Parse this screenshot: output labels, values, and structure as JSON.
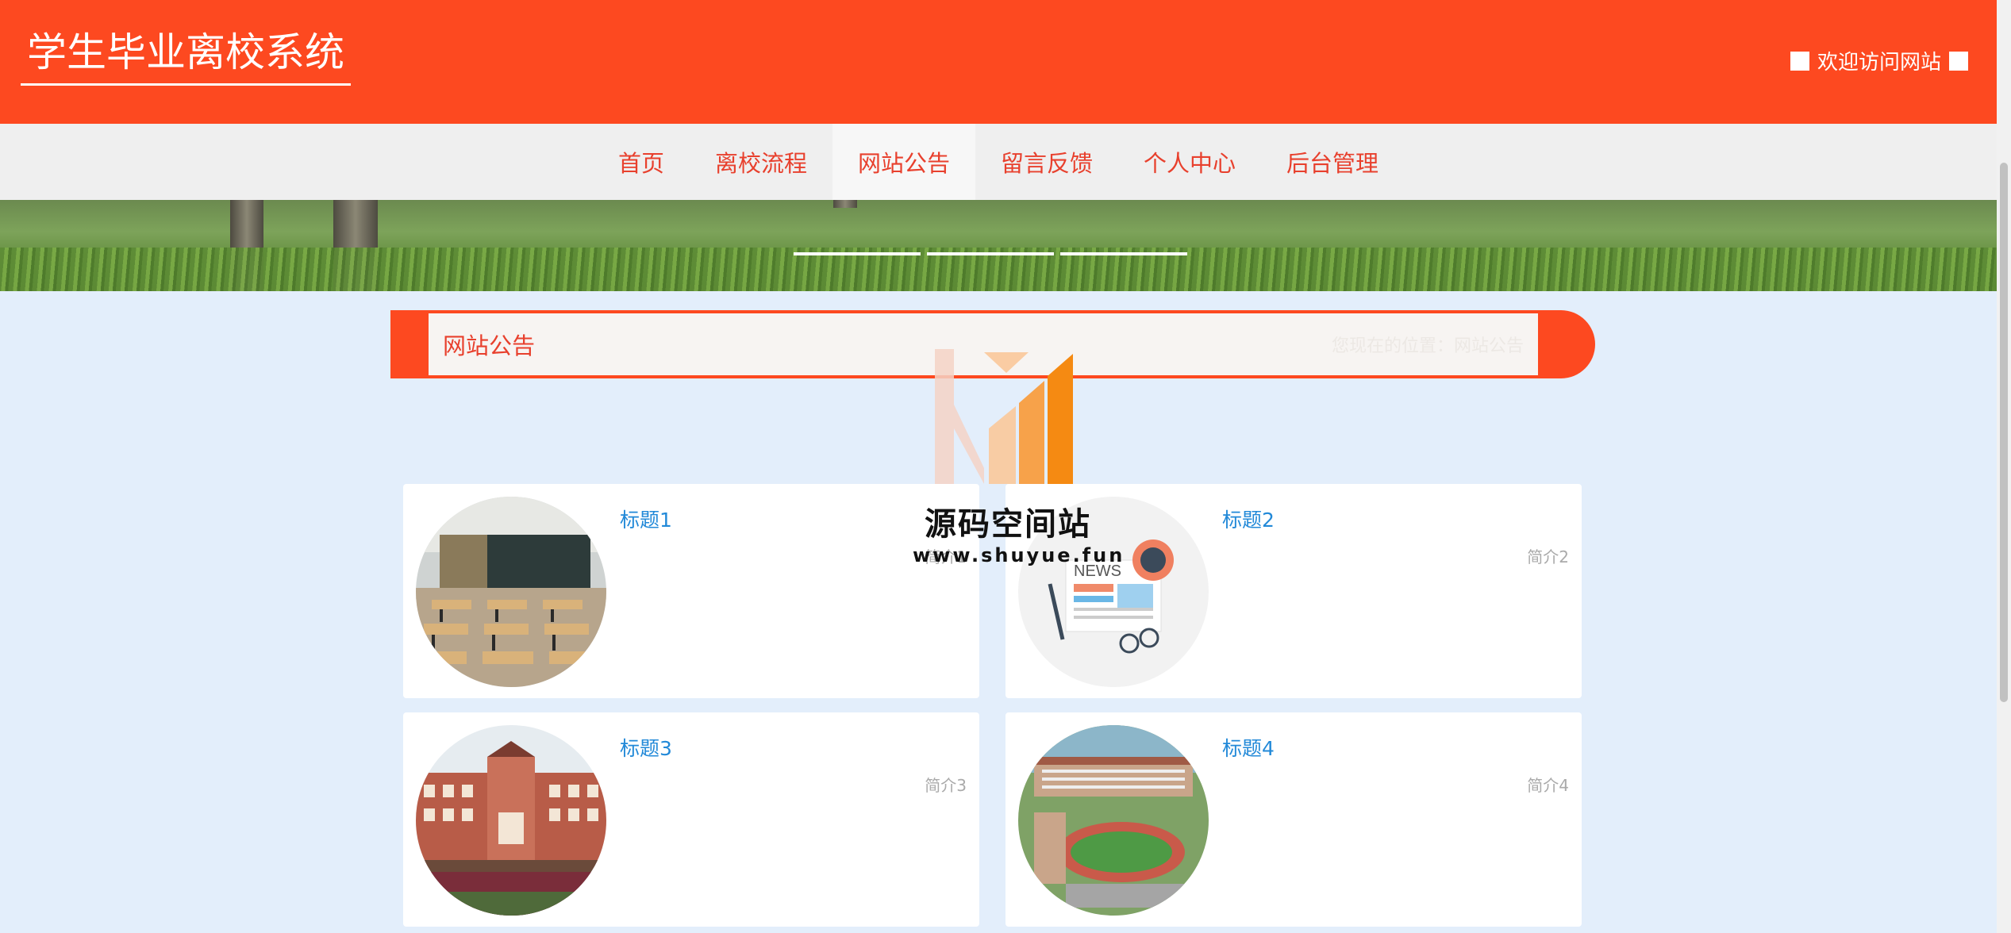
{
  "header": {
    "title": "学生毕业离校系统",
    "welcome": "欢迎访问网站"
  },
  "nav": {
    "items": [
      {
        "label": "首页"
      },
      {
        "label": "离校流程"
      },
      {
        "label": "网站公告"
      },
      {
        "label": "留言反馈"
      },
      {
        "label": "个人中心"
      },
      {
        "label": "后台管理"
      }
    ],
    "active": "网站公告"
  },
  "banner": {
    "slides_count": 3
  },
  "section": {
    "title": "网站公告",
    "subtitle": "您现在的位置：网站公告"
  },
  "cards": [
    {
      "title": "标题1",
      "intro": "简介1",
      "image": "classroom-photo"
    },
    {
      "title": "标题2",
      "intro": "简介2",
      "image": "news-illustration"
    },
    {
      "title": "标题3",
      "intro": "简介3",
      "image": "campus-building-photo"
    },
    {
      "title": "标题4",
      "intro": "简介4",
      "image": "campus-aerial-photo"
    }
  ],
  "watermark": {
    "title": "源码空间站",
    "url": "www.shuyue.fun"
  },
  "colors": {
    "brand": "#fd4920",
    "nav_text": "#e8402d",
    "link": "#2289d8",
    "page_bg": "#e3eefb"
  }
}
